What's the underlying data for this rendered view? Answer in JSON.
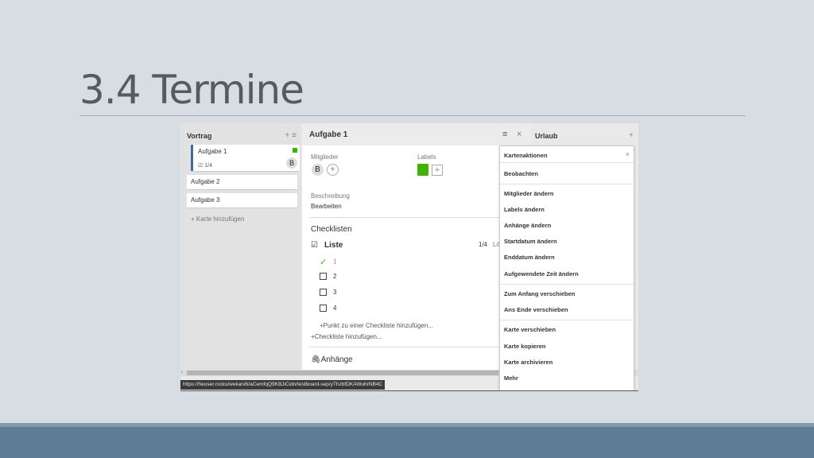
{
  "slide": {
    "title": "3.4 Termine"
  },
  "board": {
    "list_left": {
      "title": "Vortrag",
      "cards": [
        {
          "title": "Aufgabe 1",
          "checklist": "1/4",
          "avatar": "B"
        },
        {
          "title": "Aufgabe 2"
        },
        {
          "title": "Aufgabe 3"
        }
      ],
      "add_card": "Karte hinzufügen"
    },
    "details": {
      "title": "Aufgabe 1",
      "members_label": "Mitglieder",
      "member_avatar": "B",
      "labels_label": "Labels",
      "label_color": "#3cb500",
      "description_label": "Beschreibung",
      "description_value": "Bearbeiten",
      "checklists_heading": "Checklisten",
      "checklist": {
        "title": "Liste",
        "count": "1/4",
        "extra": "Lö",
        "items": [
          {
            "text": "1",
            "done": true
          },
          {
            "text": "2",
            "done": false
          },
          {
            "text": "3",
            "done": false
          },
          {
            "text": "4",
            "done": false
          }
        ],
        "add_item": "Punkt zu einer Checkliste hinzufügen...",
        "add_checklist": "Checkliste hinzufügen..."
      },
      "attachments_heading": "Anhänge"
    },
    "list_right": {
      "title": "Urlaub"
    },
    "popup": {
      "title": "Kartenaktionen",
      "items": [
        "Beobachten",
        "Mitglieder ändern",
        "Labels ändern",
        "Anhänge ändern",
        "Startdatum ändern",
        "Enddatum ändern",
        "Aufgewendete Zeit ändern",
        "Zum Anfang verschieben",
        "Ans Ende verschieben",
        "Karte verschieben",
        "Karte kopieren",
        "Karte archivieren",
        "Mehr"
      ]
    },
    "status_url": "https://heuser.rocks/wekan/b/aCemfqQ9KBJiCidn/testboard-sep/yThzbfDKAWuhrNB4C"
  }
}
